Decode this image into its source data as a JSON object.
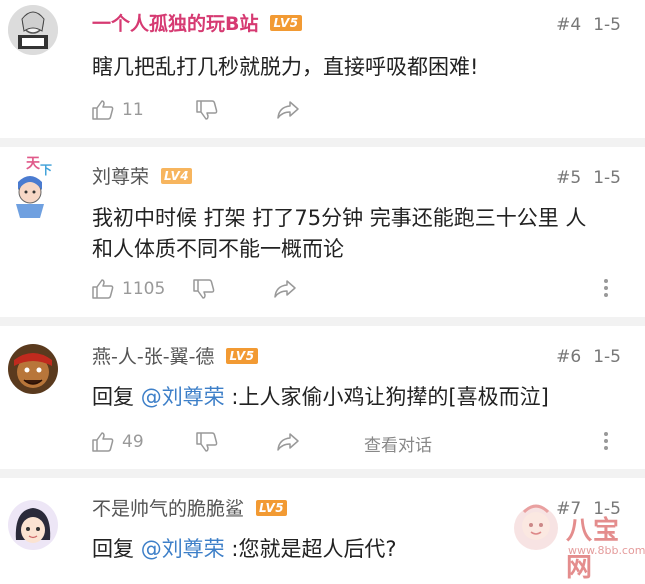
{
  "comments": [
    {
      "username": "一个人孤独的玩B站",
      "level": "LV5",
      "floor": "#4",
      "date": "1-5",
      "content": "瞎几把乱打几秒就脱力，直接呼吸都困难!",
      "likes": "11"
    },
    {
      "username": "刘尊荣",
      "level": "LV4",
      "floor": "#5",
      "date": "1-5",
      "content_line1": "我初中时候 打架 打了75分钟 完事还能跑三十公里  人",
      "content_line2": "和人体质不同不能一概而论",
      "likes": "1105"
    },
    {
      "username": "燕-人-张-翼-德",
      "level": "LV5",
      "floor": "#6",
      "date": "1-5",
      "reply_prefix": "回复 ",
      "reply_to": "@刘尊荣",
      "content": " :上人家偷小鸡让狗撵的[喜极而泣]",
      "likes": "49",
      "view_conversation": "查看对话"
    },
    {
      "username": "不是帅气的脆脆鲨",
      "level": "LV5",
      "floor": "#7",
      "date": "1-5",
      "reply_prefix": "回复 ",
      "reply_to": "@刘尊荣",
      "content": " :您就是超人后代?"
    }
  ],
  "watermark": {
    "name": "八宝网",
    "url": "www.8bb.com"
  },
  "colors": {
    "vip_name": "#d63a72",
    "level_badge": "#f29a33",
    "mention": "#3d7fc8"
  },
  "icons": [
    "like-icon",
    "dislike-icon",
    "share-icon",
    "more-icon"
  ]
}
